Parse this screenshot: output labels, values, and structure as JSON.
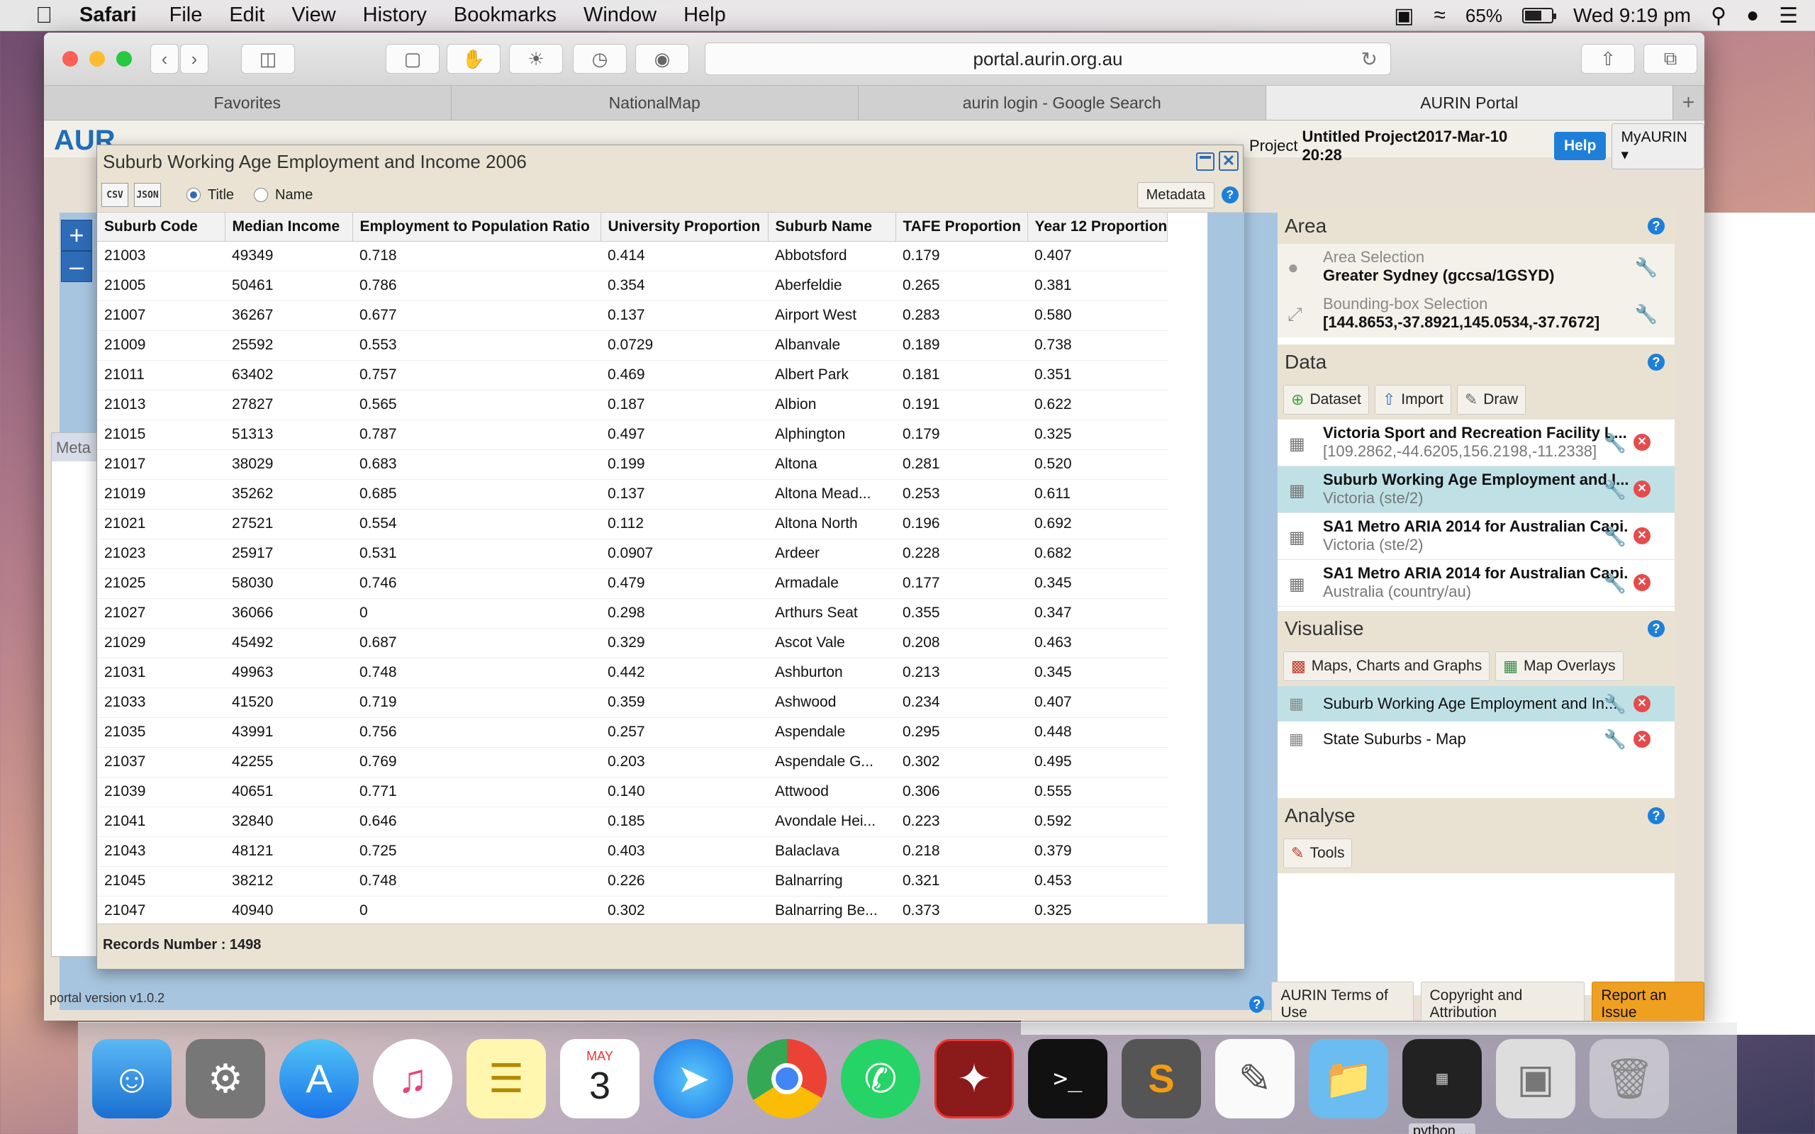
{
  "menubar": {
    "app": "Safari",
    "items": [
      "File",
      "Edit",
      "View",
      "History",
      "Bookmarks",
      "Window",
      "Help"
    ],
    "battery": "65%",
    "battery_level": 0.65,
    "clock": "Wed 9:19 pm"
  },
  "browser": {
    "url": "portal.aurin.org.au",
    "tabs": [
      "Favorites",
      "NationalMap",
      "aurin login - Google Search",
      "AURIN Portal"
    ],
    "active_tab": 3
  },
  "portal": {
    "project_label": "Project",
    "project_name": "Untitled Project2017-Mar-10 20:28",
    "help": "Help",
    "myaurin": "MyAURIN",
    "version": "portal version v1.0.2",
    "footer": {
      "terms": "AURIN Terms of Use",
      "copyright": "Copyright and Attribution",
      "report": "Report an Issue"
    },
    "meta_panel_title": "Meta"
  },
  "panel": {
    "area": {
      "title": "Area",
      "area_selection_label": "Area Selection",
      "area_selection_value": "Greater Sydney (gccsa/1GSYD)",
      "bbox_label": "Bounding-box Selection",
      "bbox_value": "[144.8653,-37.8921,145.0534,-37.7672]"
    },
    "data": {
      "title": "Data",
      "buttons": [
        "Dataset",
        "Import",
        "Draw"
      ],
      "datasets": [
        {
          "title": "Victoria Sport and Recreation Facility L...",
          "sub": "[109.2862,-44.6205,156.2198,-11.2338]"
        },
        {
          "title": "Suburb Working Age Employment and I...",
          "sub": "Victoria (ste/2)"
        },
        {
          "title": "SA1 Metro ARIA 2014 for Australian Capi...",
          "sub": "Victoria (ste/2)"
        },
        {
          "title": "SA1 Metro ARIA 2014 for Australian Capi...",
          "sub": "Australia (country/au)"
        }
      ]
    },
    "visualise": {
      "title": "Visualise",
      "buttons": [
        "Maps, Charts and Graphs",
        "Map Overlays"
      ],
      "items": [
        "Suburb Working Age Employment and In...",
        "State Suburbs - Map"
      ]
    },
    "analyse": {
      "title": "Analyse",
      "tools": "Tools"
    }
  },
  "dialog": {
    "title": "Suburb Working Age Employment and Income 2006",
    "export_csv": "CSV",
    "export_json": "JSON",
    "radio_title": "Title",
    "radio_name": "Name",
    "metadata": "Metadata",
    "columns": [
      "Suburb Code",
      "Median Income",
      "Employment to Population Ratio",
      "University Proportion",
      "Suburb Name",
      "TAFE Proportion",
      "Year 12 Proportion"
    ],
    "rows": [
      [
        "21003",
        "49349",
        "0.718",
        "0.414",
        "Abbotsford",
        "0.179",
        "0.407"
      ],
      [
        "21005",
        "50461",
        "0.786",
        "0.354",
        "Aberfeldie",
        "0.265",
        "0.381"
      ],
      [
        "21007",
        "36267",
        "0.677",
        "0.137",
        "Airport West",
        "0.283",
        "0.580"
      ],
      [
        "21009",
        "25592",
        "0.553",
        "0.0729",
        "Albanvale",
        "0.189",
        "0.738"
      ],
      [
        "21011",
        "63402",
        "0.757",
        "0.469",
        "Albert Park",
        "0.181",
        "0.351"
      ],
      [
        "21013",
        "27827",
        "0.565",
        "0.187",
        "Albion",
        "0.191",
        "0.622"
      ],
      [
        "21015",
        "51313",
        "0.787",
        "0.497",
        "Alphington",
        "0.179",
        "0.325"
      ],
      [
        "21017",
        "38029",
        "0.683",
        "0.199",
        "Altona",
        "0.281",
        "0.520"
      ],
      [
        "21019",
        "35262",
        "0.685",
        "0.137",
        "Altona Mead...",
        "0.253",
        "0.611"
      ],
      [
        "21021",
        "27521",
        "0.554",
        "0.112",
        "Altona North",
        "0.196",
        "0.692"
      ],
      [
        "21023",
        "25917",
        "0.531",
        "0.0907",
        "Ardeer",
        "0.228",
        "0.682"
      ],
      [
        "21025",
        "58030",
        "0.746",
        "0.479",
        "Armadale",
        "0.177",
        "0.345"
      ],
      [
        "21027",
        "36066",
        "0",
        "0.298",
        "Arthurs Seat",
        "0.355",
        "0.347"
      ],
      [
        "21029",
        "45492",
        "0.687",
        "0.329",
        "Ascot Vale",
        "0.208",
        "0.463"
      ],
      [
        "21031",
        "49963",
        "0.748",
        "0.442",
        "Ashburton",
        "0.213",
        "0.345"
      ],
      [
        "21033",
        "41520",
        "0.719",
        "0.359",
        "Ashwood",
        "0.234",
        "0.407"
      ],
      [
        "21035",
        "43991",
        "0.756",
        "0.257",
        "Aspendale",
        "0.295",
        "0.448"
      ],
      [
        "21037",
        "42255",
        "0.769",
        "0.203",
        "Aspendale G...",
        "0.302",
        "0.495"
      ],
      [
        "21039",
        "40651",
        "0.771",
        "0.140",
        "Attwood",
        "0.306",
        "0.555"
      ],
      [
        "21041",
        "32840",
        "0.646",
        "0.185",
        "Avondale Hei...",
        "0.223",
        "0.592"
      ],
      [
        "21043",
        "48121",
        "0.725",
        "0.403",
        "Balaclava",
        "0.218",
        "0.379"
      ],
      [
        "21045",
        "38212",
        "0.748",
        "0.226",
        "Balnarring",
        "0.321",
        "0.453"
      ],
      [
        "21047",
        "40940",
        "0",
        "0.302",
        "Balnarring Be...",
        "0.373",
        "0.325"
      ]
    ],
    "records": "Records Number : 1498"
  },
  "dock": {
    "apps": [
      "Finder",
      "System Preferences",
      "App Store",
      "iTunes",
      "Notes",
      "Calendar",
      "Safari",
      "Chrome",
      "WhatsApp",
      "Acrobat",
      "Terminal",
      "Sublime Text",
      "TextEdit",
      "Folder",
      "python ...",
      "Preview",
      "Trash"
    ],
    "calendar_month": "MAY",
    "calendar_day": "3",
    "python_label": "python ..."
  }
}
